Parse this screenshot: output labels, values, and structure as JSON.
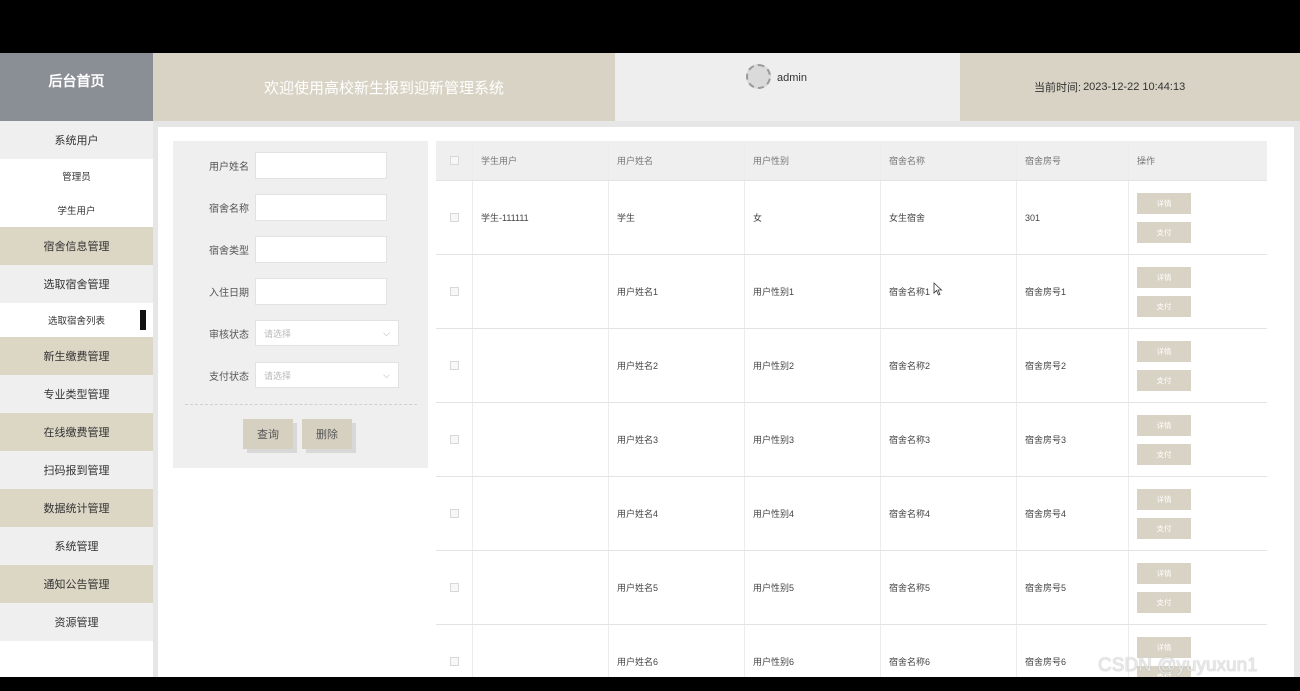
{
  "header": {
    "home_label": "后台首页",
    "system_title": "欢迎使用高校新生报到迎新管理系统",
    "username": "admin",
    "time_label": "当前时间:",
    "time_value": "2023-12-22 10:44:13"
  },
  "sidebar": {
    "items": [
      {
        "label": "系统用户"
      },
      {
        "label": "管理员"
      },
      {
        "label": "学生用户"
      },
      {
        "label": "宿舍信息管理"
      },
      {
        "label": "选取宿舍管理"
      },
      {
        "label": "选取宿舍列表"
      },
      {
        "label": "新生缴费管理"
      },
      {
        "label": "专业类型管理"
      },
      {
        "label": "在线缴费管理"
      },
      {
        "label": "扫码报到管理"
      },
      {
        "label": "数据统计管理"
      },
      {
        "label": "系统管理"
      },
      {
        "label": "通知公告管理"
      },
      {
        "label": "资源管理"
      }
    ]
  },
  "form": {
    "fields": [
      {
        "label": "用户姓名",
        "value": ""
      },
      {
        "label": "宿舍名称",
        "value": ""
      },
      {
        "label": "宿舍类型",
        "value": ""
      },
      {
        "label": "入住日期",
        "value": ""
      }
    ],
    "selects": [
      {
        "label": "审核状态",
        "placeholder": "请选择"
      },
      {
        "label": "支付状态",
        "placeholder": "请选择"
      }
    ],
    "query_label": "查询",
    "delete_label": "删除"
  },
  "table": {
    "columns": [
      "学生用户",
      "用户姓名",
      "用户性别",
      "宿舍名称",
      "宿舍房号",
      "操作"
    ],
    "detail_label": "详情",
    "pay_label": "支付",
    "rows": [
      [
        "学生-111111",
        "学生",
        "女",
        "女生宿舍",
        "301"
      ],
      [
        "",
        "用户姓名1",
        "用户性别1",
        "宿舍名称1",
        "宿舍房号1"
      ],
      [
        "",
        "用户姓名2",
        "用户性别2",
        "宿舍名称2",
        "宿舍房号2"
      ],
      [
        "",
        "用户姓名3",
        "用户性别3",
        "宿舍名称3",
        "宿舍房号3"
      ],
      [
        "",
        "用户姓名4",
        "用户性别4",
        "宿舍名称4",
        "宿舍房号4"
      ],
      [
        "",
        "用户姓名5",
        "用户性别5",
        "宿舍名称5",
        "宿舍房号5"
      ],
      [
        "",
        "用户姓名6",
        "用户性别6",
        "宿舍名称6",
        "宿舍房号6"
      ]
    ]
  },
  "watermark": "CSDN @yuyuxun1"
}
